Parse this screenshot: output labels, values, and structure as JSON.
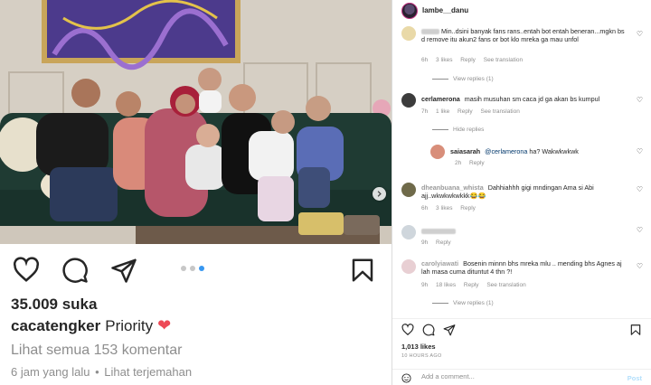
{
  "post": {
    "likes_text": "35.009 suka",
    "username": "cacatengker",
    "caption": "Priority",
    "view_comments": "Lihat semua 153 komentar",
    "time_ago": "6 jam yang lalu",
    "separator": "•",
    "see_translation": "Lihat terjemahan",
    "carousel": {
      "count": 3,
      "active": 3
    }
  },
  "panel": {
    "account": "lambe__danu",
    "comments": [
      {
        "user": "",
        "text": "Min..dsini banyak fans rans..entah bot entah beneran...mgkn bs d remove itu akun2 fans or bot klo mreka ga mau unfol",
        "time": "6h",
        "likes": "3 likes",
        "reply": "Reply",
        "translate": "See translation",
        "view_replies": "View replies (1)"
      },
      {
        "user": "cerlamerona",
        "text": "masih musuhan sm caca jd ga akan bs kumpul",
        "time": "7h",
        "likes": "1 like",
        "reply": "Reply",
        "translate": "See translation",
        "hide_replies": "Hide replies"
      },
      {
        "user": "saiasarah",
        "mention": "@cerlamerona",
        "text": "ha? Wakwkwkwk",
        "time": "2h",
        "reply": "Reply"
      },
      {
        "user": "dheanbuana_whista",
        "text": "Dahhiahhh gigi mndingan Ama si Abi ajj..wkwkwkwkkk😂😂",
        "time": "6h",
        "likes": "3 likes",
        "reply": "Reply"
      },
      {
        "user": "",
        "text": "",
        "time": "9h",
        "reply": "Reply"
      },
      {
        "user": "carolyiawati",
        "text": "Bosenin minnn bhs mreka mlu .. mending bhs Agnes aj lah masa cuma dituntut 4 thn ?!",
        "time": "9h",
        "likes": "18 likes",
        "reply": "Reply",
        "translate": "See translation",
        "view_replies": "View replies (1)"
      }
    ],
    "likes_total": "1,013 likes",
    "time_posted": "10 HOURS AGO",
    "add_comment_placeholder": "Add a comment...",
    "post_label": "Post"
  },
  "colors": {
    "link_blue": "#3797f0",
    "like_red": "#ed4956",
    "text": "#262626",
    "muted": "#8e8e8e"
  },
  "icons": [
    "heart-icon",
    "comment-icon",
    "share-icon",
    "bookmark-icon",
    "chevron-right-icon",
    "emoji-icon"
  ]
}
